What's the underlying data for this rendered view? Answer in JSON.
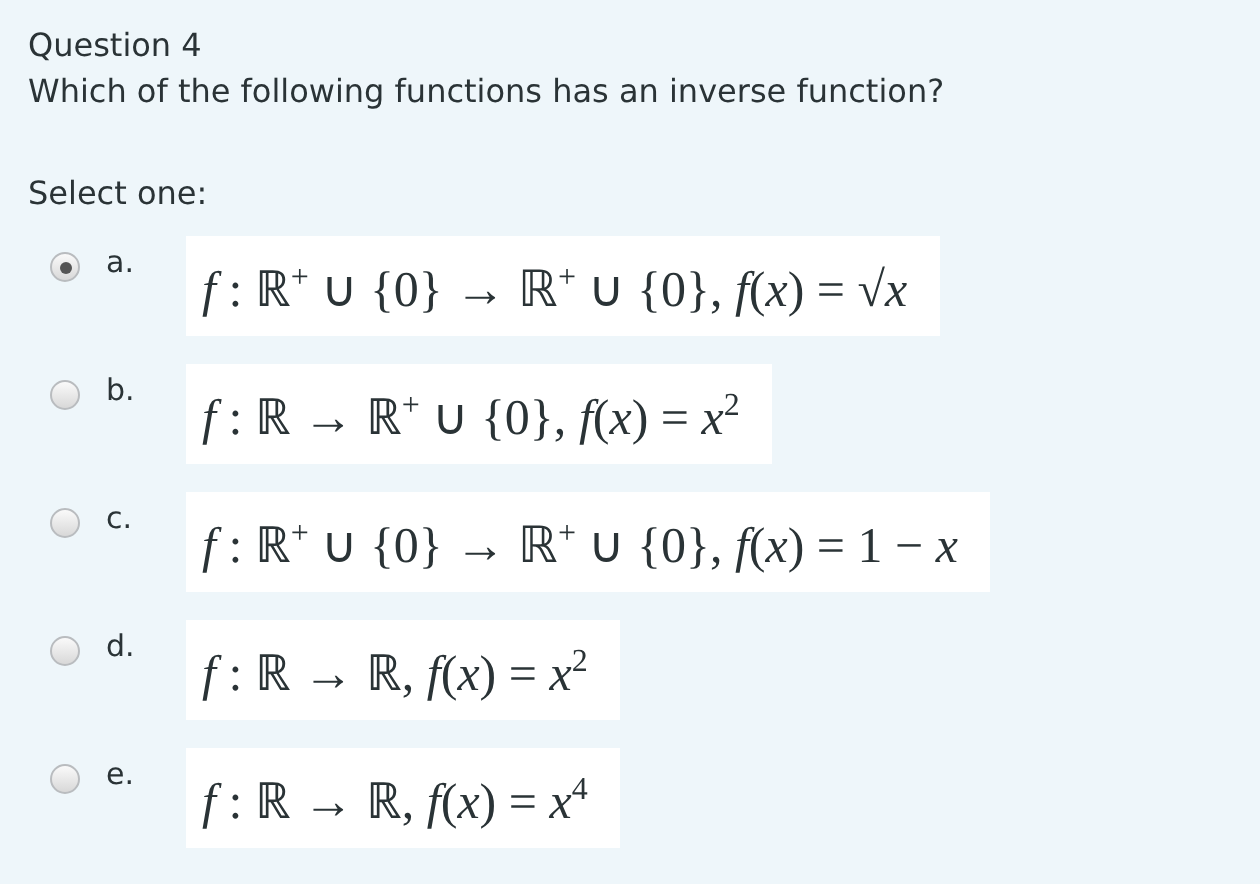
{
  "question": {
    "title": "Question 4",
    "text": "Which of the following functions has an inverse function?",
    "prompt": "Select one:"
  },
  "options": [
    {
      "letter": "a.",
      "formula": "*f* : ℝ$^{+}$ ∪ {0} → ℝ$^{+}$ ∪ {0}, *f*(*x*) = √*x*",
      "selected": true
    },
    {
      "letter": "b.",
      "formula": "*f* : ℝ → ℝ$^{+}$ ∪ {0}, *f*(*x*) = *x*$^{2}$",
      "selected": false
    },
    {
      "letter": "c.",
      "formula": "*f* : ℝ$^{+}$ ∪ {0} → ℝ$^{+}$ ∪ {0}, *f*(*x*) = 1 − *x*",
      "selected": false
    },
    {
      "letter": "d.",
      "formula": "*f* : ℝ → ℝ, *f*(*x*) = *x*$^{2}$",
      "selected": false
    },
    {
      "letter": "e.",
      "formula": "*f* : ℝ → ℝ, *f*(*x*) = *x*$^{4}$",
      "selected": false
    }
  ]
}
